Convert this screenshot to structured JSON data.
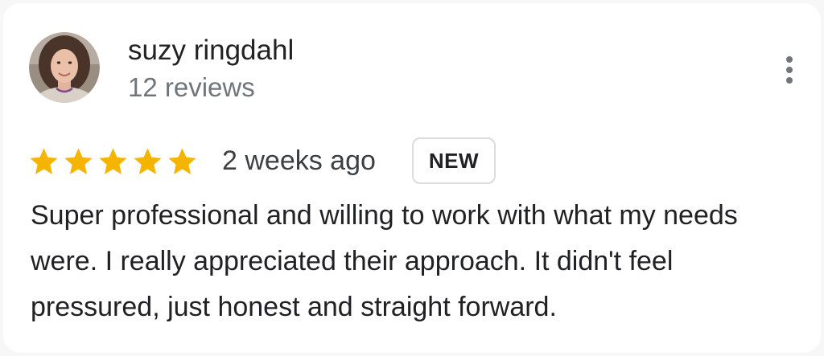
{
  "reviewer": {
    "name": "suzy ringdahl",
    "review_count": "12 reviews"
  },
  "review": {
    "rating": 5,
    "max_rating": 5,
    "star_color": "#f4b400",
    "date": "2 weeks ago",
    "badge": "NEW",
    "text": "Super professional and willing to work with what my needs were. I really appreciated their approach. It didn't feel pressured, just honest and straight forward."
  },
  "actions": {
    "more_icon": "more-vertical-icon"
  }
}
